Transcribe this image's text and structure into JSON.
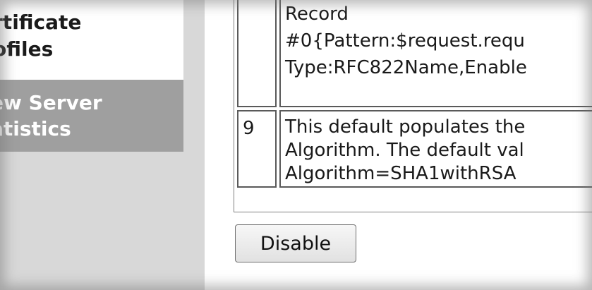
{
  "sidebar": {
    "items": [
      {
        "line1": "rtificate",
        "line2": "ofiles"
      },
      {
        "line1": "ew Server",
        "line2": "atistics"
      }
    ]
  },
  "table": {
    "rows": [
      {
        "number": "",
        "lines": [
          "Record",
          "#0{Pattern:$request.requ",
          "Type:RFC822Name,Enable"
        ]
      },
      {
        "number": "9",
        "lines": [
          "This default populates the",
          "Algorithm. The default val",
          "Algorithm=SHA1withRSA"
        ]
      }
    ]
  },
  "actions": {
    "disable_label": "Disable"
  }
}
